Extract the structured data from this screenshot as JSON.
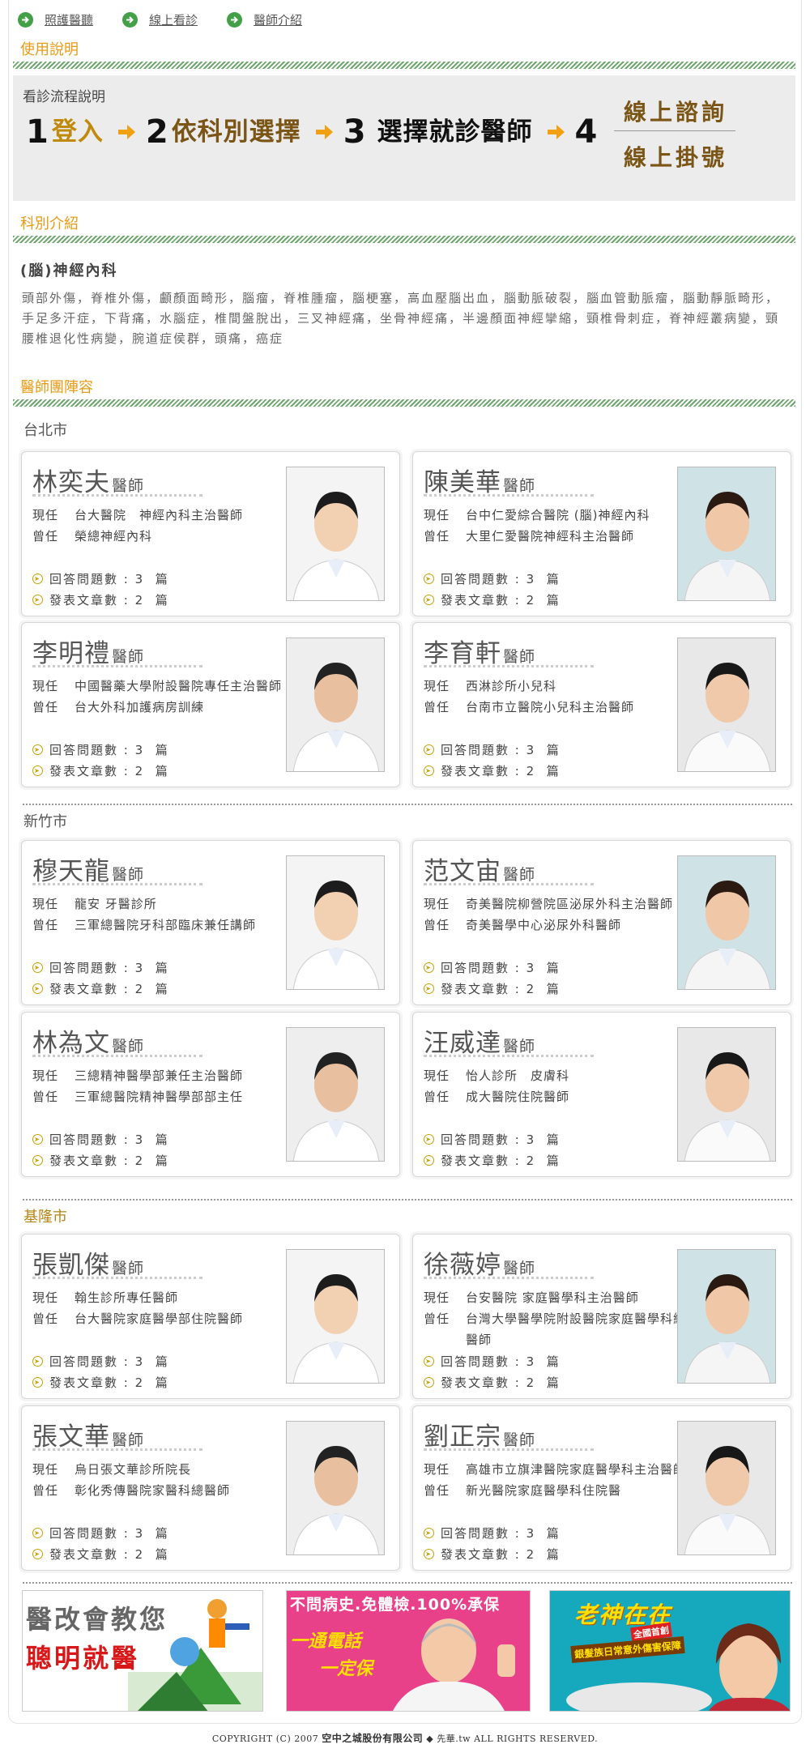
{
  "nav": {
    "items": [
      {
        "label": "照護醫聽"
      },
      {
        "label": "線上看診"
      },
      {
        "label": "醫師介紹"
      }
    ]
  },
  "sections": {
    "usage": "使用說明",
    "dept": "科別介紹",
    "team": "醫師團陣容"
  },
  "flow": {
    "caption": "看診流程說明",
    "steps": [
      {
        "num": "1",
        "label": "登入",
        "color": "#c08a0c"
      },
      {
        "num": "2",
        "label": "依科別選擇",
        "color": "#7a5515"
      },
      {
        "num": "3",
        "label": "選擇就診醫師",
        "color": "#111111"
      },
      {
        "num": "4",
        "label": "",
        "color": "#111111"
      }
    ],
    "options": [
      "線上諮詢",
      "線上掛號"
    ]
  },
  "dept": {
    "title": "(腦)神經內科",
    "description": "頭部外傷，脊椎外傷，顱顏面畸形，腦瘤，脊椎腫瘤，腦梗塞，高血壓腦出血，腦動脈破裂，腦血管動脈瘤，腦動靜脈畸形，手足多汗症，下背痛，水腦症，椎間盤脫出，三叉神經痛，坐骨神經痛，半邊顏面神經攣縮，頸椎骨刺症，脊神經叢病變，頸腰椎退化性病變，腕道症侯群，頭痛，癌症"
  },
  "cities": [
    {
      "name": "台北市",
      "doctors": [
        {
          "name": "林奕夫",
          "title": "醫師",
          "current_label": "現任",
          "current": "台大醫院　神經內科主治醫師",
          "former_label": "曾任",
          "former": "榮總神經內科"
        },
        {
          "name": "陳美華",
          "title": "醫師",
          "current_label": "現任",
          "current": "台中仁愛綜合醫院 (腦)神經內科",
          "former_label": "曾任",
          "former": "大里仁愛醫院神經科主治醫師"
        },
        {
          "name": "李明禮",
          "title": "醫師",
          "current_label": "現任",
          "current": "中國醫藥大學附設醫院專任主治醫師",
          "former_label": "曾任",
          "former": "台大外科加護病房訓練"
        },
        {
          "name": "李育軒",
          "title": "醫師",
          "current_label": "現任",
          "current": "西淋診所小兒科",
          "former_label": "曾任",
          "former": "台南市立醫院小兒科主治醫師"
        }
      ]
    },
    {
      "name": "新竹市",
      "doctors": [
        {
          "name": "穆天龍",
          "title": "醫師",
          "current_label": "現任",
          "current": "龍安 牙醫診所",
          "former_label": "曾任",
          "former": "三軍總醫院牙科部臨床兼任講師"
        },
        {
          "name": "范文宙",
          "title": "醫師",
          "current_label": "現任",
          "current": "奇美醫院柳營院區泌尿外科主治醫師",
          "former_label": "曾任",
          "former": "奇美醫學中心泌尿外科醫師"
        },
        {
          "name": "林為文",
          "title": "醫師",
          "current_label": "現任",
          "current": "三總精神醫學部兼任主治醫師",
          "former_label": "曾任",
          "former": "三軍總醫院精神醫學部部主任"
        },
        {
          "name": "汪威達",
          "title": "醫師",
          "current_label": "現任",
          "current": "怡人診所　皮膚科",
          "former_label": "曾任",
          "former": "成大醫院住院醫師"
        }
      ]
    },
    {
      "name": "基隆市",
      "doctors": [
        {
          "name": "張凱傑",
          "title": "醫師",
          "current_label": "現任",
          "current": "翰生診所專任醫師",
          "former_label": "曾任",
          "former": "台大醫院家庭醫學部住院醫師"
        },
        {
          "name": "徐薇婷",
          "title": "醫師",
          "current_label": "現任",
          "current": "台安醫院 家庭醫學科主治醫師",
          "former_label": "曾任",
          "former": "台灣大學醫學院附設醫院家庭醫學科總醫師"
        },
        {
          "name": "張文華",
          "title": "醫師",
          "current_label": "現任",
          "current": "烏日張文華診所院長",
          "former_label": "曾任",
          "former": "彰化秀傳醫院家醫科總醫師"
        },
        {
          "name": "劉正宗",
          "title": "醫師",
          "current_label": "現任",
          "current": "高雄市立旗津醫院家庭醫學科主治醫師",
          "former_label": "曾任",
          "former": "新光醫院家庭醫學科住院醫"
        }
      ]
    }
  ],
  "stats": {
    "answers_label": "回答問題數",
    "answers": "3",
    "articles_label": "發表文章數",
    "articles": "2",
    "unit": "篇"
  },
  "ads": [
    {
      "line1": "醫改會教您",
      "line2": "聰明就醫"
    },
    {
      "headline": "不問病史.免體檢.100%承保",
      "sub1": "一通電話",
      "sub2": "一定保"
    },
    {
      "title": "老神在在",
      "badge": "全國首創",
      "sub": "銀髮族日常意外傷害保障"
    }
  ],
  "footer": {
    "prefix": "COPYRIGHT (C) 2007 ",
    "company": "空中之城股份有限公司",
    "mid": " ◆ 先華.tw ",
    "suffix": "ALL RIGHTS RESERVED."
  },
  "colors": {
    "accent": "#e89b14",
    "nav_icon": "#43a047",
    "stripe": "#6ea66e",
    "arrow": "#f0a010"
  }
}
